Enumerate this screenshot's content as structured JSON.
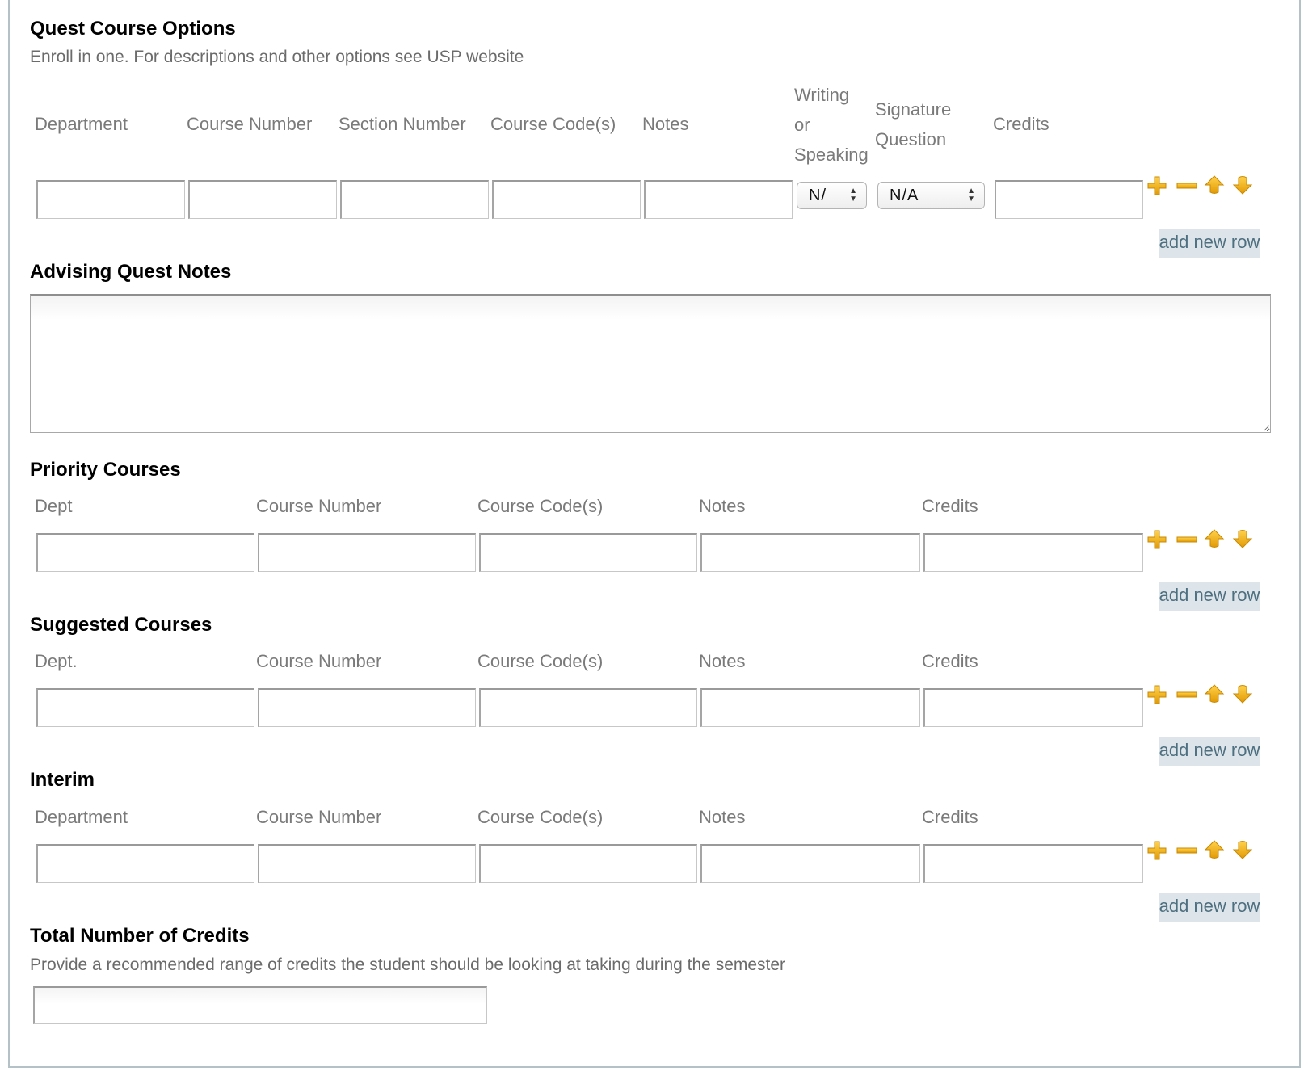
{
  "quest": {
    "title": "Quest Course Options",
    "description": "Enroll in one. For descriptions and other options see USP website",
    "headers": {
      "department": "Department",
      "course_number": "Course Number",
      "section_number": "Section Number",
      "course_codes": "Course Code(s)",
      "notes": "Notes",
      "writing_line1": "Writing",
      "writing_line2": "or",
      "writing_line3": "Speaking",
      "signature_line1": "Signature",
      "signature_line2": "Question",
      "credits": "Credits"
    },
    "writing_select_value": "N/",
    "signature_select_value": "N/A",
    "add_row_label": "add new row"
  },
  "advising": {
    "title": "Advising Quest Notes"
  },
  "priority": {
    "title": "Priority Courses",
    "headers": {
      "dept": "Dept",
      "course_number": "Course Number",
      "course_codes": "Course Code(s)",
      "notes": "Notes",
      "credits": "Credits"
    },
    "add_row_label": "add new row"
  },
  "suggested": {
    "title": "Suggested Courses",
    "headers": {
      "dept": "Dept.",
      "course_number": "Course Number",
      "course_codes": "Course Code(s)",
      "notes": "Notes",
      "credits": "Credits"
    },
    "add_row_label": "add new row"
  },
  "interim": {
    "title": "Interim",
    "headers": {
      "dept": "Department",
      "course_number": "Course Number",
      "course_codes": "Course Code(s)",
      "notes": "Notes",
      "credits": "Credits"
    },
    "add_row_label": "add new row"
  },
  "total": {
    "title": "Total Number of Credits",
    "description": "Provide a recommended range of credits the student should be looking at taking during the semester"
  },
  "icons": {
    "add": "plus-icon",
    "remove": "minus-icon",
    "move_up": "arrow-up-icon",
    "move_down": "arrow-down-icon",
    "color": "#f0b31c"
  }
}
